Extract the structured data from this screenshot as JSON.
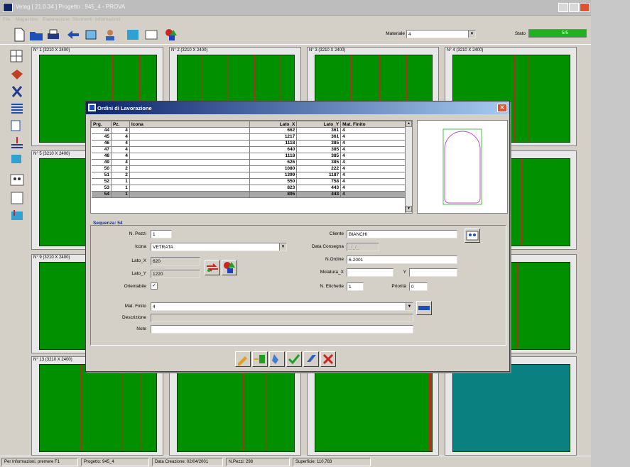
{
  "window": {
    "title": "Vetag [ 21.0.34 ] Progetto : 945_4 - PROVA"
  },
  "menu": [
    "File",
    "Magazzino",
    "Elaborazione",
    "Strumenti",
    "Informazioni"
  ],
  "toolbar": {
    "materiale_label": "Materiale",
    "materiale_value": "4",
    "stato_label": "Stato",
    "stato_value": "5/5"
  },
  "tiles": [
    {
      "label": "N° 1 (3210 X 2400)"
    },
    {
      "label": "N° 2 (3210 X 2400)"
    },
    {
      "label": "N° 3 (3210 X 2400)"
    },
    {
      "label": "N° 4 (3210 X 2400)"
    },
    {
      "label": "N° 5 (3210 X 2400)"
    },
    {
      "label": ""
    },
    {
      "label": ""
    },
    {
      "label": ""
    },
    {
      "label": "N° 9 (3210 X 2400)"
    },
    {
      "label": ""
    },
    {
      "label": ""
    },
    {
      "label": ""
    },
    {
      "label": "N° 13 (3210 X 2400)"
    },
    {
      "label": ""
    },
    {
      "label": ""
    },
    {
      "label": ""
    }
  ],
  "status": {
    "hint": "Per Informazioni, premere F1",
    "progetto": "Progetto: 945_4",
    "data": "Data Creazione: 02/04/2001",
    "pezzi": "N.Pezzi: 298",
    "superficie": "Superficie: 110,783"
  },
  "dialog": {
    "title": "Ordini di Lavorazione",
    "columns": [
      "Prg.",
      "Pz.",
      "Icona",
      "Lato_X",
      "Lato_Y",
      "Mat. Finito"
    ],
    "rows": [
      [
        "44",
        "4",
        "",
        "662",
        "361",
        "4"
      ],
      [
        "45",
        "4",
        "",
        "1217",
        "361",
        "4"
      ],
      [
        "46",
        "4",
        "",
        "1118",
        "385",
        "4"
      ],
      [
        "47",
        "4",
        "",
        "640",
        "385",
        "4"
      ],
      [
        "48",
        "4",
        "",
        "1118",
        "385",
        "4"
      ],
      [
        "49",
        "4",
        "",
        "626",
        "385",
        "4"
      ],
      [
        "50",
        "2",
        "",
        "1080",
        "222",
        "4"
      ],
      [
        "51",
        "2",
        "",
        "1399",
        "1187",
        "4"
      ],
      [
        "52",
        "1",
        "",
        "550",
        "758",
        "4"
      ],
      [
        "53",
        "1",
        "",
        "823",
        "443",
        "4"
      ],
      [
        "54",
        "1",
        "",
        "895",
        "443",
        "4"
      ]
    ],
    "sequenza": "Sequenza: 54",
    "form": {
      "npezzi_label": "N. Pezzi",
      "npezzi": "1",
      "icona_label": "Icona",
      "icona": "VETRATA",
      "latox_label": "Lato_X",
      "latox": "620",
      "latoy_label": "Lato_Y",
      "latoy": "1220",
      "orientabile_label": "Orientabile",
      "cliente_label": "Cliente",
      "cliente": "BIANCHI",
      "consegna_label": "Data Consegna",
      "consegna": "_/_/_",
      "nordine_label": "N.Ordine",
      "nordine": "6-2001",
      "molatura_label": "Molatura_X",
      "y_label": "Y",
      "etichette_label": "N. Etichette",
      "etichette": "1",
      "priorita_label": "Priorità",
      "priorita": "0",
      "matfinito_label": "Mat. Finito",
      "matfinito": "4",
      "descrizione_label": "Descrizione",
      "note_label": "Note"
    }
  }
}
